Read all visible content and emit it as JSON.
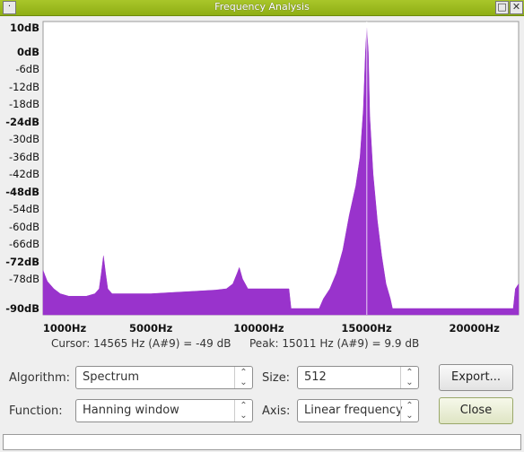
{
  "window": {
    "title": "Frequency Analysis",
    "menu_icon": "dot-menu-icon",
    "maximize_icon": "maximize-icon",
    "close_icon": "close-x-icon"
  },
  "chart_data": {
    "type": "area",
    "ylabels": [
      {
        "text": "10dB",
        "value": 10,
        "bold": true
      },
      {
        "text": "0dB",
        "value": 0,
        "bold": true
      },
      {
        "text": "-6dB",
        "value": -6,
        "bold": false
      },
      {
        "text": "-12dB",
        "value": -12,
        "bold": false
      },
      {
        "text": "-18dB",
        "value": -18,
        "bold": false
      },
      {
        "text": "-24dB",
        "value": -24,
        "bold": true
      },
      {
        "text": "-30dB",
        "value": -30,
        "bold": false
      },
      {
        "text": "-36dB",
        "value": -36,
        "bold": false
      },
      {
        "text": "-42dB",
        "value": -42,
        "bold": false
      },
      {
        "text": "-48dB",
        "value": -48,
        "bold": true
      },
      {
        "text": "-54dB",
        "value": -54,
        "bold": false
      },
      {
        "text": "-60dB",
        "value": -60,
        "bold": false
      },
      {
        "text": "-66dB",
        "value": -66,
        "bold": false
      },
      {
        "text": "-72dB",
        "value": -72,
        "bold": true
      },
      {
        "text": "-78dB",
        "value": -78,
        "bold": false
      },
      {
        "text": "-90dB",
        "value": -90,
        "bold": true
      }
    ],
    "xlabels": [
      {
        "text": "1000Hz",
        "value": 1000
      },
      {
        "text": "5000Hz",
        "value": 5000
      },
      {
        "text": "10000Hz",
        "value": 10000
      },
      {
        "text": "15000Hz",
        "value": 15000
      },
      {
        "text": "20000Hz",
        "value": 20000
      }
    ],
    "xlim": [
      0,
      22050
    ],
    "ylim": [
      -90,
      10
    ],
    "color": "#9933cc",
    "cursor_hz": 15011,
    "spectrum": [
      [
        0,
        -75
      ],
      [
        100,
        -77
      ],
      [
        200,
        -79
      ],
      [
        300,
        -80
      ],
      [
        500,
        -82
      ],
      [
        800,
        -84
      ],
      [
        1200,
        -85
      ],
      [
        1600,
        -85
      ],
      [
        2000,
        -85
      ],
      [
        2400,
        -84
      ],
      [
        2600,
        -82
      ],
      [
        2700,
        -76
      ],
      [
        2800,
        -70
      ],
      [
        2900,
        -76
      ],
      [
        3000,
        -82
      ],
      [
        3200,
        -84
      ],
      [
        3600,
        -84
      ],
      [
        4200,
        -84
      ],
      [
        5000,
        -84
      ],
      [
        6000,
        -83.5
      ],
      [
        7000,
        -83
      ],
      [
        8000,
        -82.5
      ],
      [
        8500,
        -82
      ],
      [
        8800,
        -80
      ],
      [
        9000,
        -76
      ],
      [
        9100,
        -74
      ],
      [
        9250,
        -78
      ],
      [
        9500,
        -82
      ],
      [
        10000,
        -82
      ],
      [
        10500,
        -82
      ],
      [
        11000,
        -82
      ],
      [
        11400,
        -82
      ],
      [
        11500,
        -90
      ],
      [
        12800,
        -90
      ],
      [
        13000,
        -86
      ],
      [
        13300,
        -82
      ],
      [
        13600,
        -76
      ],
      [
        13900,
        -68
      ],
      [
        14200,
        -56
      ],
      [
        14500,
        -46
      ],
      [
        14700,
        -36
      ],
      [
        14850,
        -20
      ],
      [
        14950,
        0
      ],
      [
        15011,
        9.9
      ],
      [
        15080,
        0
      ],
      [
        15150,
        -22
      ],
      [
        15300,
        -42
      ],
      [
        15500,
        -58
      ],
      [
        15700,
        -70
      ],
      [
        15900,
        -80
      ],
      [
        16100,
        -86
      ],
      [
        16200,
        -90
      ],
      [
        21800,
        -90
      ],
      [
        21900,
        -82
      ],
      [
        22050,
        -80
      ]
    ]
  },
  "status": {
    "cursor": "Cursor: 14565 Hz (A#9) = -49 dB",
    "peak": "Peak: 15011 Hz (A#9) = 9.9 dB"
  },
  "controls": {
    "algorithm_label": "Algorithm:",
    "algorithm_value": "Spectrum",
    "size_label": "Size:",
    "size_value": "512",
    "function_label": "Function:",
    "function_value": "Hanning window",
    "axis_label": "Axis:",
    "axis_value": "Linear frequency",
    "export_label": "Export...",
    "close_label": "Close",
    "arrow_icon": "updown-arrow-icon"
  }
}
